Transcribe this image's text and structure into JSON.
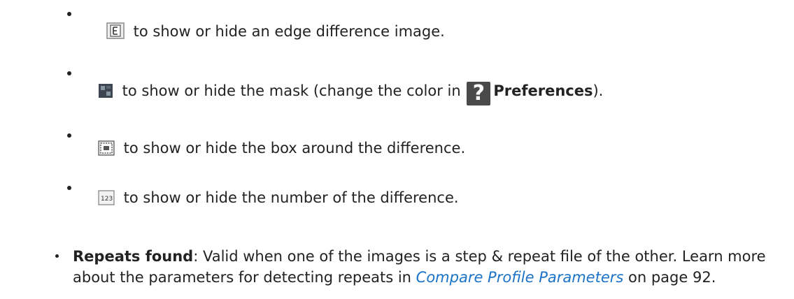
{
  "items": [
    {
      "icon": "edge-difference-icon",
      "text": " to show or hide an edge difference image."
    },
    {
      "icon": "mask-icon",
      "text_before": " to show or hide the mask (change the color in ",
      "help_icon": "help-icon",
      "bold": "Preferences",
      "text_after": ")."
    },
    {
      "icon": "box-icon",
      "text": " to show or hide the box around the difference."
    },
    {
      "icon": "number-icon",
      "text": " to show or hide the number of the difference."
    }
  ],
  "repeats": {
    "term": "Repeats found",
    "text1": ": Valid when one of the images is a step & repeat file of the other. Learn more about the parameters for detecting repeats in ",
    "link": "Compare Profile Parameters",
    "text2": " on page 92."
  }
}
